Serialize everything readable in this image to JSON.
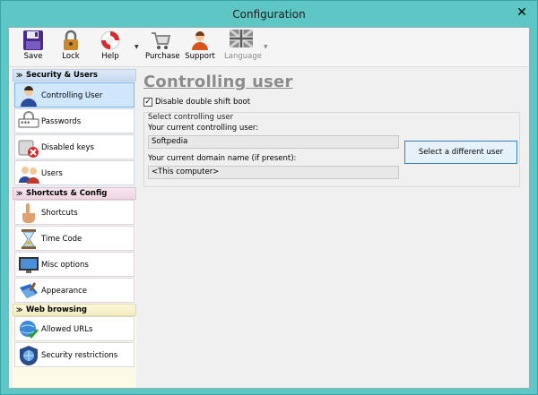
{
  "window": {
    "title": "Configuration",
    "close_glyph": "✕"
  },
  "toolbar": {
    "buttons": [
      {
        "label": "Save",
        "icon": "floppy-disk-icon"
      },
      {
        "label": "Lock",
        "icon": "padlock-icon"
      },
      {
        "label": "Help",
        "icon": "lifebuoy-icon"
      },
      {
        "label": "Purchase",
        "icon": "shopping-cart-icon"
      },
      {
        "label": "Support",
        "icon": "support-person-icon"
      },
      {
        "label": "Language",
        "icon": "uk-flag-icon",
        "disabled": true
      }
    ],
    "dropdown_glyph": "▼"
  },
  "sidebar": {
    "categories": [
      {
        "label": "Security & Users",
        "color": "#dde9f7",
        "items": [
          {
            "label": "Controlling User",
            "icon": "user-icon",
            "selected": true
          },
          {
            "label": "Passwords",
            "icon": "password-field-icon"
          },
          {
            "label": "Disabled keys",
            "icon": "disabled-key-icon"
          },
          {
            "label": "Users",
            "icon": "users-group-icon"
          }
        ]
      },
      {
        "label": "Shortcuts & Config",
        "color": "#f7e7ef",
        "items": [
          {
            "label": "Shortcuts",
            "icon": "pointing-hand-icon"
          },
          {
            "label": "Time Code",
            "icon": "hourglass-icon"
          },
          {
            "label": "Misc options",
            "icon": "monitor-icon"
          },
          {
            "label": "Appearance",
            "icon": "paint-book-icon"
          }
        ]
      },
      {
        "label": "Web browsing",
        "color": "#fbf6d9",
        "items": [
          {
            "label": "Allowed URLs",
            "icon": "globe-check-icon"
          },
          {
            "label": "Security restrictions",
            "icon": "shield-globe-icon"
          }
        ]
      }
    ],
    "collapse_glyph": "≫"
  },
  "main": {
    "page_title": "Controlling user",
    "disable_shift_boot": {
      "label": "Disable double shift boot",
      "checked": true,
      "check_glyph": "✓"
    },
    "group": {
      "title": "Select controlling user",
      "current_user_label": "Your current controlling user:",
      "current_user_value": "Softpedia",
      "domain_label": "Your current domain name (if present):",
      "domain_value": "<This computer>",
      "select_button": "Select a different user"
    }
  },
  "colors": {
    "titlebar": "#5fc6c6",
    "selected_item": "#cfe6fb",
    "button_border": "#3c7fb1"
  }
}
